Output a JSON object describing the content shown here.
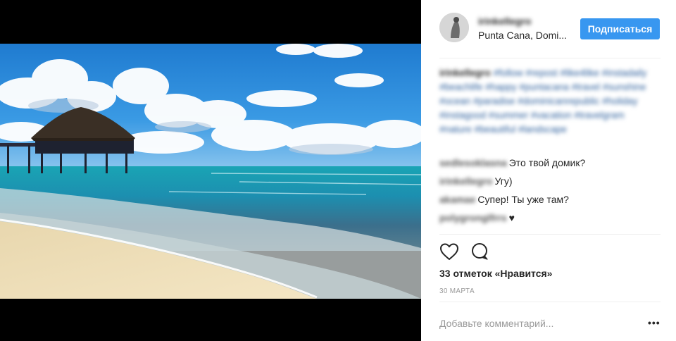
{
  "header": {
    "username": "irinkellegro",
    "location": "Punta Cana, Domi...",
    "follow_label": "Подписаться"
  },
  "caption": {
    "username": "irinkellegro",
    "text": "#follow #repost #like4like #instadaily #beachlife #happy #puntacana #travel #sunshine #ocean #paradise #dominicanrepublic #holiday #instagood #summer #vacation #travelgram #nature #beautiful #landscape"
  },
  "comments": [
    {
      "username": "sedlesoklasna",
      "text": "Это твой домик?"
    },
    {
      "username": "irinkellegro",
      "text": "Угу)"
    },
    {
      "username": "akamae",
      "text": "Супер! Ты уже там?"
    },
    {
      "username": "polygronglfrrs",
      "text": "♥"
    }
  ],
  "likes_text": "33 отметок «Нравится»",
  "date_text": "30 МАРТА",
  "add_comment_placeholder": "Добавьте комментарий...",
  "more_label": "•••",
  "icons": [
    "heart-icon",
    "comment-icon",
    "more-options-icon"
  ],
  "colors": {
    "accent": "#3897f0",
    "text": "#262626",
    "muted": "#999999",
    "separator": "#efefef"
  }
}
